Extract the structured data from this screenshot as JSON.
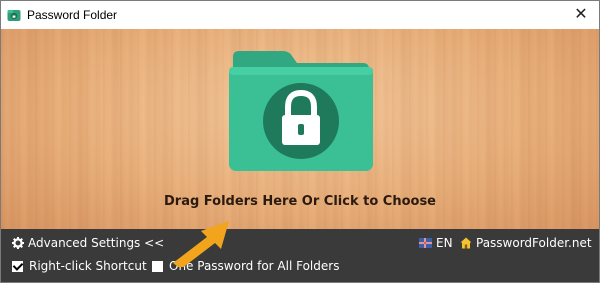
{
  "window": {
    "title": "Password Folder",
    "close_symbol": "✕"
  },
  "drop_area": {
    "text": "Drag Folders Here Or Click to Choose",
    "icon": "locked-folder-icon"
  },
  "panel": {
    "advanced_settings": "Advanced Settings <<",
    "language": "EN",
    "website": "PasswordFolder.net",
    "right_click_shortcut": {
      "label": "Right-click Shortcut",
      "checked": true
    },
    "one_password": {
      "label": "One Password for All Folders",
      "checked": false
    }
  },
  "colors": {
    "panel_bg": "#3a3a3a",
    "folder_green": "#3bbf95",
    "arrow_orange": "#f2a51c"
  }
}
